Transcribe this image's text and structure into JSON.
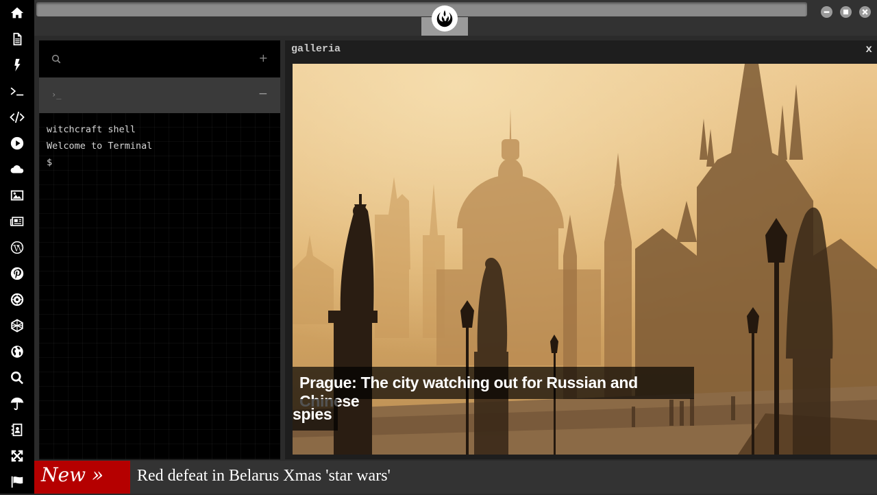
{
  "top_bar": {
    "logo_icon": "rebel-alliance-logo-icon",
    "window_buttons": [
      "minimize-icon",
      "maximize-icon",
      "close-icon"
    ]
  },
  "sidebar": {
    "icons": [
      "home-icon",
      "document-icon",
      "lightning-icon",
      "terminal-icon",
      "code-icon",
      "play-icon",
      "cloud-icon",
      "image-icon",
      "newspaper-icon",
      "wordpress-icon",
      "pinterest-icon",
      "empire-icon",
      "network-icon",
      "globe-icon",
      "search-icon",
      "umbrella-icon",
      "contacts-icon",
      "fullscreen-icon",
      "flag-icon"
    ]
  },
  "terminal": {
    "search_icon": "search-icon",
    "add_symbol": "+",
    "tab_prompt": "›_",
    "collapse_symbol": "−",
    "lines": [
      "witchcraft shell",
      "Welcome to Terminal",
      "$"
    ]
  },
  "galleria": {
    "title": "galleria",
    "close": "x",
    "caption_line1": "Prague: The city watching out for Russian and Chinese",
    "caption_line2": "spies"
  },
  "ticker": {
    "tag": "New »",
    "headline": "Red defeat in Belarus Xmas 'star wars'"
  },
  "colors": {
    "rail_bg": "#000000",
    "panel_bg": "#2b2b2b",
    "ticker_tag": "#b50000",
    "photo_tone": "#e0b26a"
  }
}
